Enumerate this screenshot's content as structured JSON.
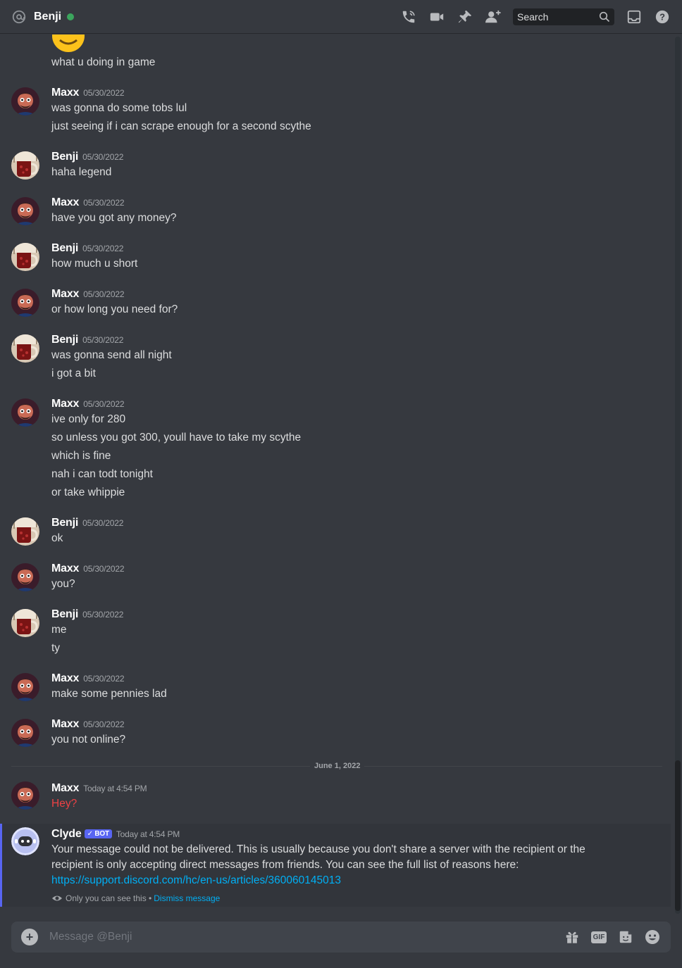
{
  "header": {
    "title": "Benji",
    "search_placeholder": "Search",
    "icons": [
      "at-icon",
      "phone-call-icon",
      "video-icon",
      "pin-icon",
      "add-member-icon",
      "search-icon",
      "inbox-icon",
      "help-icon"
    ],
    "status_color": "#3ba55d"
  },
  "messages": [
    {
      "author": "",
      "timestamp": "",
      "lines": [
        "what u doing in game"
      ]
    },
    {
      "author": "Maxx",
      "timestamp": "05/30/2022",
      "lines": [
        "was gonna do some tobs lul",
        "just seeing if i can scrape enough for a second scythe"
      ]
    },
    {
      "author": "Benji",
      "timestamp": "05/30/2022",
      "lines": [
        "haha legend"
      ]
    },
    {
      "author": "Maxx",
      "timestamp": "05/30/2022",
      "lines": [
        "have you got any money?"
      ]
    },
    {
      "author": "Benji",
      "timestamp": "05/30/2022",
      "lines": [
        "how much u short"
      ]
    },
    {
      "author": "Maxx",
      "timestamp": "05/30/2022",
      "lines": [
        "or how long you need for?"
      ]
    },
    {
      "author": "Benji",
      "timestamp": "05/30/2022",
      "lines": [
        "was gonna send all night",
        "i got a bit"
      ]
    },
    {
      "author": "Maxx",
      "timestamp": "05/30/2022",
      "lines": [
        "ive only for 280",
        "so unless you got 300, youll have to take my scythe",
        "which is fine",
        "nah i can todt tonight",
        "or take whippie"
      ]
    },
    {
      "author": "Benji",
      "timestamp": "05/30/2022",
      "lines": [
        "ok"
      ]
    },
    {
      "author": "Maxx",
      "timestamp": "05/30/2022",
      "lines": [
        "you?"
      ]
    },
    {
      "author": "Benji",
      "timestamp": "05/30/2022",
      "lines": [
        "me",
        "ty"
      ]
    },
    {
      "author": "Maxx",
      "timestamp": "05/30/2022",
      "lines": [
        "make some pennies lad"
      ]
    },
    {
      "author": "Maxx",
      "timestamp": "05/30/2022",
      "lines": [
        "you not online?"
      ]
    }
  ],
  "divider": {
    "label": "June 1, 2022"
  },
  "failed_message": {
    "author": "Maxx",
    "timestamp": "Today at 4:54 PM",
    "text": "Hey?",
    "color": "#ed4245"
  },
  "clyde": {
    "author": "Clyde",
    "bot_tag": "BOT",
    "timestamp": "Today at 4:54 PM",
    "text": "Your message could not be delivered. This is usually because you don't share a server with the recipient or the recipient is only accepting direct messages from friends. You can see the full list of reasons here: ",
    "link": "https://support.discord.com/hc/en-us/articles/360060145013",
    "only_you": "Only you can see this •",
    "dismiss": "Dismiss message"
  },
  "composer": {
    "placeholder": "Message @Benji",
    "gif_label": "GIF",
    "icons": [
      "plus-icon",
      "gift-icon",
      "gif-icon",
      "sticker-icon",
      "emoji-icon"
    ]
  }
}
